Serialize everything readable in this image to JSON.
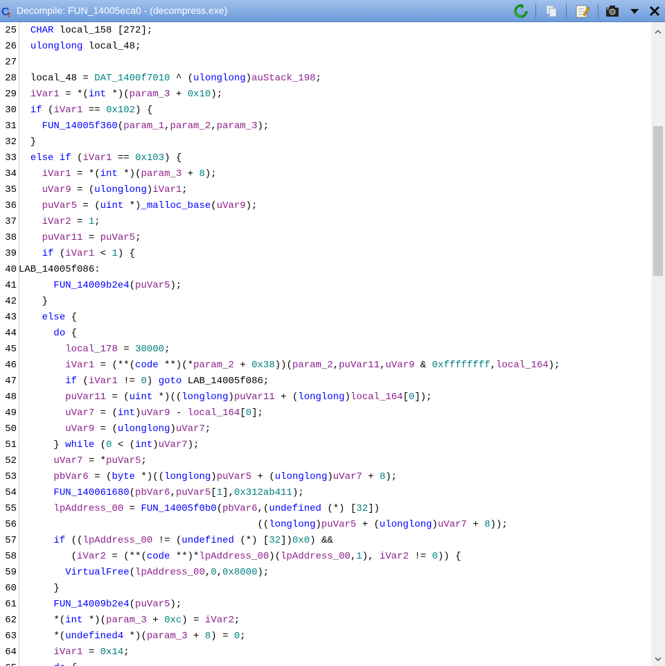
{
  "window": {
    "title": "Decompile: FUN_14005eca0 -  (decompress.exe)",
    "toolbar": [
      "refresh-icon",
      "copy-icon",
      "edit-icon",
      "snapshot-icon",
      "dropdown-icon",
      "close-icon"
    ]
  },
  "colors": {
    "keyword": "#0000ff",
    "variable": "#8b1f8b",
    "global": "#008080",
    "function": "#0000ff",
    "number": "#008080"
  },
  "code_lines": [
    {
      "num": "25",
      "tokens": [
        [
          "  ",
          ""
        ],
        [
          "CHAR",
          "k"
        ],
        [
          " local_158 [272];",
          ""
        ]
      ]
    },
    {
      "num": "26",
      "tokens": [
        [
          "  ",
          ""
        ],
        [
          "ulonglong",
          "k"
        ],
        [
          " local_48;",
          ""
        ]
      ]
    },
    {
      "num": "27",
      "tokens": [
        [
          "",
          ""
        ]
      ]
    },
    {
      "num": "28",
      "tokens": [
        [
          "  local_48 = ",
          ""
        ],
        [
          "DAT_1400f7010",
          "g"
        ],
        [
          " ^ (",
          ""
        ],
        [
          "ulonglong",
          "k"
        ],
        [
          ")",
          ""
        ],
        [
          "auStack_198",
          "v"
        ],
        [
          ";",
          ""
        ]
      ]
    },
    {
      "num": "29",
      "tokens": [
        [
          "  ",
          ""
        ],
        [
          "iVar1",
          "v"
        ],
        [
          " = *(",
          ""
        ],
        [
          "int",
          "k"
        ],
        [
          " *)(",
          ""
        ],
        [
          "param_3",
          "v"
        ],
        [
          " + ",
          ""
        ],
        [
          "0x10",
          "n"
        ],
        [
          ");",
          ""
        ]
      ]
    },
    {
      "num": "30",
      "tokens": [
        [
          "  ",
          ""
        ],
        [
          "if",
          "k"
        ],
        [
          " (",
          ""
        ],
        [
          "iVar1",
          "v"
        ],
        [
          " == ",
          ""
        ],
        [
          "0x102",
          "n"
        ],
        [
          ") {",
          ""
        ]
      ]
    },
    {
      "num": "31",
      "tokens": [
        [
          "    ",
          ""
        ],
        [
          "FUN_14005f360",
          "f"
        ],
        [
          "(",
          ""
        ],
        [
          "param_1",
          "v"
        ],
        [
          ",",
          ""
        ],
        [
          "param_2",
          "v"
        ],
        [
          ",",
          ""
        ],
        [
          "param_3",
          "v"
        ],
        [
          ");",
          ""
        ]
      ]
    },
    {
      "num": "32",
      "tokens": [
        [
          "  }",
          ""
        ]
      ]
    },
    {
      "num": "33",
      "tokens": [
        [
          "  ",
          ""
        ],
        [
          "else if",
          "k"
        ],
        [
          " (",
          ""
        ],
        [
          "iVar1",
          "v"
        ],
        [
          " == ",
          ""
        ],
        [
          "0x103",
          "n"
        ],
        [
          ") {",
          ""
        ]
      ]
    },
    {
      "num": "34",
      "tokens": [
        [
          "    ",
          ""
        ],
        [
          "iVar1",
          "v"
        ],
        [
          " = *(",
          ""
        ],
        [
          "int",
          "k"
        ],
        [
          " *)(",
          ""
        ],
        [
          "param_3",
          "v"
        ],
        [
          " + ",
          ""
        ],
        [
          "8",
          "n"
        ],
        [
          ");",
          ""
        ]
      ]
    },
    {
      "num": "35",
      "tokens": [
        [
          "    ",
          ""
        ],
        [
          "uVar9",
          "v"
        ],
        [
          " = (",
          ""
        ],
        [
          "ulonglong",
          "k"
        ],
        [
          ")",
          ""
        ],
        [
          "iVar1",
          "v"
        ],
        [
          ";",
          ""
        ]
      ]
    },
    {
      "num": "36",
      "tokens": [
        [
          "    ",
          ""
        ],
        [
          "puVar5",
          "v"
        ],
        [
          " = (",
          ""
        ],
        [
          "uint",
          "k"
        ],
        [
          " *)",
          ""
        ],
        [
          "_malloc_base",
          "f"
        ],
        [
          "(",
          ""
        ],
        [
          "uVar9",
          "v"
        ],
        [
          ");",
          ""
        ]
      ]
    },
    {
      "num": "37",
      "tokens": [
        [
          "    ",
          ""
        ],
        [
          "iVar2",
          "v"
        ],
        [
          " = ",
          ""
        ],
        [
          "1",
          "n"
        ],
        [
          ";",
          ""
        ]
      ]
    },
    {
      "num": "38",
      "tokens": [
        [
          "    ",
          ""
        ],
        [
          "puVar11",
          "v"
        ],
        [
          " = ",
          ""
        ],
        [
          "puVar5",
          "v"
        ],
        [
          ";",
          ""
        ]
      ]
    },
    {
      "num": "39",
      "tokens": [
        [
          "    ",
          ""
        ],
        [
          "if",
          "k"
        ],
        [
          " (",
          ""
        ],
        [
          "iVar1",
          "v"
        ],
        [
          " < ",
          ""
        ],
        [
          "1",
          "n"
        ],
        [
          ") {",
          ""
        ]
      ]
    },
    {
      "num": "40",
      "tokens": [
        [
          "LAB_14005f086:",
          ""
        ]
      ]
    },
    {
      "num": "41",
      "tokens": [
        [
          "      ",
          ""
        ],
        [
          "FUN_14009b2e4",
          "f"
        ],
        [
          "(",
          ""
        ],
        [
          "puVar5",
          "v"
        ],
        [
          ");",
          ""
        ]
      ]
    },
    {
      "num": "42",
      "tokens": [
        [
          "    }",
          ""
        ]
      ]
    },
    {
      "num": "43",
      "tokens": [
        [
          "    ",
          ""
        ],
        [
          "else",
          "k"
        ],
        [
          " {",
          ""
        ]
      ]
    },
    {
      "num": "44",
      "tokens": [
        [
          "      ",
          ""
        ],
        [
          "do",
          "k"
        ],
        [
          " {",
          ""
        ]
      ]
    },
    {
      "num": "45",
      "tokens": [
        [
          "        ",
          ""
        ],
        [
          "local_178",
          "v"
        ],
        [
          " = ",
          ""
        ],
        [
          "30000",
          "n"
        ],
        [
          ";",
          ""
        ]
      ]
    },
    {
      "num": "46",
      "tokens": [
        [
          "        ",
          ""
        ],
        [
          "iVar1",
          "v"
        ],
        [
          " = (**(",
          ""
        ],
        [
          "code",
          "k"
        ],
        [
          " **)(*",
          ""
        ],
        [
          "param_2",
          "v"
        ],
        [
          " + ",
          ""
        ],
        [
          "0x38",
          "n"
        ],
        [
          "))(",
          ""
        ],
        [
          "param_2",
          "v"
        ],
        [
          ",",
          ""
        ],
        [
          "puVar11",
          "v"
        ],
        [
          ",",
          ""
        ],
        [
          "uVar9",
          "v"
        ],
        [
          " & ",
          ""
        ],
        [
          "0xffffffff",
          "n"
        ],
        [
          ",",
          ""
        ],
        [
          "local_164",
          "v"
        ],
        [
          ");",
          ""
        ]
      ]
    },
    {
      "num": "47",
      "tokens": [
        [
          "        ",
          ""
        ],
        [
          "if",
          "k"
        ],
        [
          " (",
          ""
        ],
        [
          "iVar1",
          "v"
        ],
        [
          " != ",
          ""
        ],
        [
          "0",
          "n"
        ],
        [
          ") ",
          ""
        ],
        [
          "goto",
          "k"
        ],
        [
          " LAB_14005f086;",
          ""
        ]
      ]
    },
    {
      "num": "48",
      "tokens": [
        [
          "        ",
          ""
        ],
        [
          "puVar11",
          "v"
        ],
        [
          " = (",
          ""
        ],
        [
          "uint",
          "k"
        ],
        [
          " *)((",
          ""
        ],
        [
          "longlong",
          "k"
        ],
        [
          ")",
          ""
        ],
        [
          "puVar11",
          "v"
        ],
        [
          " + (",
          ""
        ],
        [
          "longlong",
          "k"
        ],
        [
          ")",
          ""
        ],
        [
          "local_164",
          "v"
        ],
        [
          "[",
          ""
        ],
        [
          "0",
          "n"
        ],
        [
          "]);",
          ""
        ]
      ]
    },
    {
      "num": "49",
      "tokens": [
        [
          "        ",
          ""
        ],
        [
          "uVar7",
          "v"
        ],
        [
          " = (",
          ""
        ],
        [
          "int",
          "k"
        ],
        [
          ")",
          ""
        ],
        [
          "uVar9",
          "v"
        ],
        [
          " - ",
          ""
        ],
        [
          "local_164",
          "v"
        ],
        [
          "[",
          ""
        ],
        [
          "0",
          "n"
        ],
        [
          "];",
          ""
        ]
      ]
    },
    {
      "num": "50",
      "tokens": [
        [
          "        ",
          ""
        ],
        [
          "uVar9",
          "v"
        ],
        [
          " = (",
          ""
        ],
        [
          "ulonglong",
          "k"
        ],
        [
          ")",
          ""
        ],
        [
          "uVar7",
          "v"
        ],
        [
          ";",
          ""
        ]
      ]
    },
    {
      "num": "51",
      "tokens": [
        [
          "      } ",
          ""
        ],
        [
          "while",
          "k"
        ],
        [
          " (",
          ""
        ],
        [
          "0",
          "n"
        ],
        [
          " < (",
          ""
        ],
        [
          "int",
          "k"
        ],
        [
          ")",
          ""
        ],
        [
          "uVar7",
          "v"
        ],
        [
          ");",
          ""
        ]
      ]
    },
    {
      "num": "52",
      "tokens": [
        [
          "      ",
          ""
        ],
        [
          "uVar7",
          "v"
        ],
        [
          " = *",
          ""
        ],
        [
          "puVar5",
          "v"
        ],
        [
          ";",
          ""
        ]
      ]
    },
    {
      "num": "53",
      "tokens": [
        [
          "      ",
          ""
        ],
        [
          "pbVar6",
          "v"
        ],
        [
          " = (",
          ""
        ],
        [
          "byte",
          "k"
        ],
        [
          " *)((",
          ""
        ],
        [
          "longlong",
          "k"
        ],
        [
          ")",
          ""
        ],
        [
          "puVar5",
          "v"
        ],
        [
          " + (",
          ""
        ],
        [
          "ulonglong",
          "k"
        ],
        [
          ")",
          ""
        ],
        [
          "uVar7",
          "v"
        ],
        [
          " + ",
          ""
        ],
        [
          "8",
          "n"
        ],
        [
          ");",
          ""
        ]
      ]
    },
    {
      "num": "54",
      "tokens": [
        [
          "      ",
          ""
        ],
        [
          "FUN_140061680",
          "f"
        ],
        [
          "(",
          ""
        ],
        [
          "pbVar6",
          "v"
        ],
        [
          ",",
          ""
        ],
        [
          "puVar5",
          "v"
        ],
        [
          "[",
          ""
        ],
        [
          "1",
          "n"
        ],
        [
          "],",
          ""
        ],
        [
          "0x312ab411",
          "n"
        ],
        [
          ");",
          ""
        ]
      ]
    },
    {
      "num": "55",
      "tokens": [
        [
          "      ",
          ""
        ],
        [
          "lpAddress_00",
          "v"
        ],
        [
          " = ",
          ""
        ],
        [
          "FUN_14005f0b0",
          "f"
        ],
        [
          "(",
          ""
        ],
        [
          "pbVar6",
          "v"
        ],
        [
          ",(",
          ""
        ],
        [
          "undefined",
          "k"
        ],
        [
          " (*) [",
          ""
        ],
        [
          "32",
          "n"
        ],
        [
          "])",
          ""
        ]
      ]
    },
    {
      "num": "56",
      "tokens": [
        [
          "                                         ((",
          ""
        ],
        [
          "longlong",
          "k"
        ],
        [
          ")",
          ""
        ],
        [
          "puVar5",
          "v"
        ],
        [
          " + (",
          ""
        ],
        [
          "ulonglong",
          "k"
        ],
        [
          ")",
          ""
        ],
        [
          "uVar7",
          "v"
        ],
        [
          " + ",
          ""
        ],
        [
          "8",
          "n"
        ],
        [
          "));",
          ""
        ]
      ]
    },
    {
      "num": "57",
      "tokens": [
        [
          "      ",
          ""
        ],
        [
          "if",
          "k"
        ],
        [
          " ((",
          ""
        ],
        [
          "lpAddress_00",
          "v"
        ],
        [
          " != (",
          ""
        ],
        [
          "undefined",
          "k"
        ],
        [
          " (*) [",
          ""
        ],
        [
          "32",
          "n"
        ],
        [
          "])",
          ""
        ],
        [
          "0x0",
          "n"
        ],
        [
          ") &&",
          ""
        ]
      ]
    },
    {
      "num": "58",
      "tokens": [
        [
          "         (",
          ""
        ],
        [
          "iVar2",
          "v"
        ],
        [
          " = (**(",
          ""
        ],
        [
          "code",
          "k"
        ],
        [
          " **)*",
          ""
        ],
        [
          "lpAddress_00",
          "v"
        ],
        [
          ")(",
          ""
        ],
        [
          "lpAddress_00",
          "v"
        ],
        [
          ",",
          ""
        ],
        [
          "1",
          "n"
        ],
        [
          "), ",
          ""
        ],
        [
          "iVar2",
          "v"
        ],
        [
          " != ",
          ""
        ],
        [
          "0",
          "n"
        ],
        [
          ")) {",
          ""
        ]
      ]
    },
    {
      "num": "59",
      "tokens": [
        [
          "        ",
          ""
        ],
        [
          "VirtualFree",
          "f"
        ],
        [
          "(",
          ""
        ],
        [
          "lpAddress_00",
          "v"
        ],
        [
          ",",
          ""
        ],
        [
          "0",
          "n"
        ],
        [
          ",",
          ""
        ],
        [
          "0x8000",
          "n"
        ],
        [
          ");",
          ""
        ]
      ]
    },
    {
      "num": "60",
      "tokens": [
        [
          "      }",
          ""
        ]
      ]
    },
    {
      "num": "61",
      "tokens": [
        [
          "      ",
          ""
        ],
        [
          "FUN_14009b2e4",
          "f"
        ],
        [
          "(",
          ""
        ],
        [
          "puVar5",
          "v"
        ],
        [
          ");",
          ""
        ]
      ]
    },
    {
      "num": "62",
      "tokens": [
        [
          "      *(",
          ""
        ],
        [
          "int",
          "k"
        ],
        [
          " *)(",
          ""
        ],
        [
          "param_3",
          "v"
        ],
        [
          " + ",
          ""
        ],
        [
          "0xc",
          "n"
        ],
        [
          ") = ",
          ""
        ],
        [
          "iVar2",
          "v"
        ],
        [
          ";",
          ""
        ]
      ]
    },
    {
      "num": "63",
      "tokens": [
        [
          "      *(",
          ""
        ],
        [
          "undefined4",
          "k"
        ],
        [
          " *)(",
          ""
        ],
        [
          "param_3",
          "v"
        ],
        [
          " + ",
          ""
        ],
        [
          "8",
          "n"
        ],
        [
          ") = ",
          ""
        ],
        [
          "0",
          "n"
        ],
        [
          ";",
          ""
        ]
      ]
    },
    {
      "num": "64",
      "tokens": [
        [
          "      ",
          ""
        ],
        [
          "iVar1",
          "v"
        ],
        [
          " = ",
          ""
        ],
        [
          "0x14",
          "n"
        ],
        [
          ";",
          ""
        ]
      ]
    },
    {
      "num": "65",
      "tokens": [
        [
          "      ",
          ""
        ],
        [
          "do",
          "k"
        ],
        [
          " {",
          ""
        ]
      ]
    }
  ]
}
